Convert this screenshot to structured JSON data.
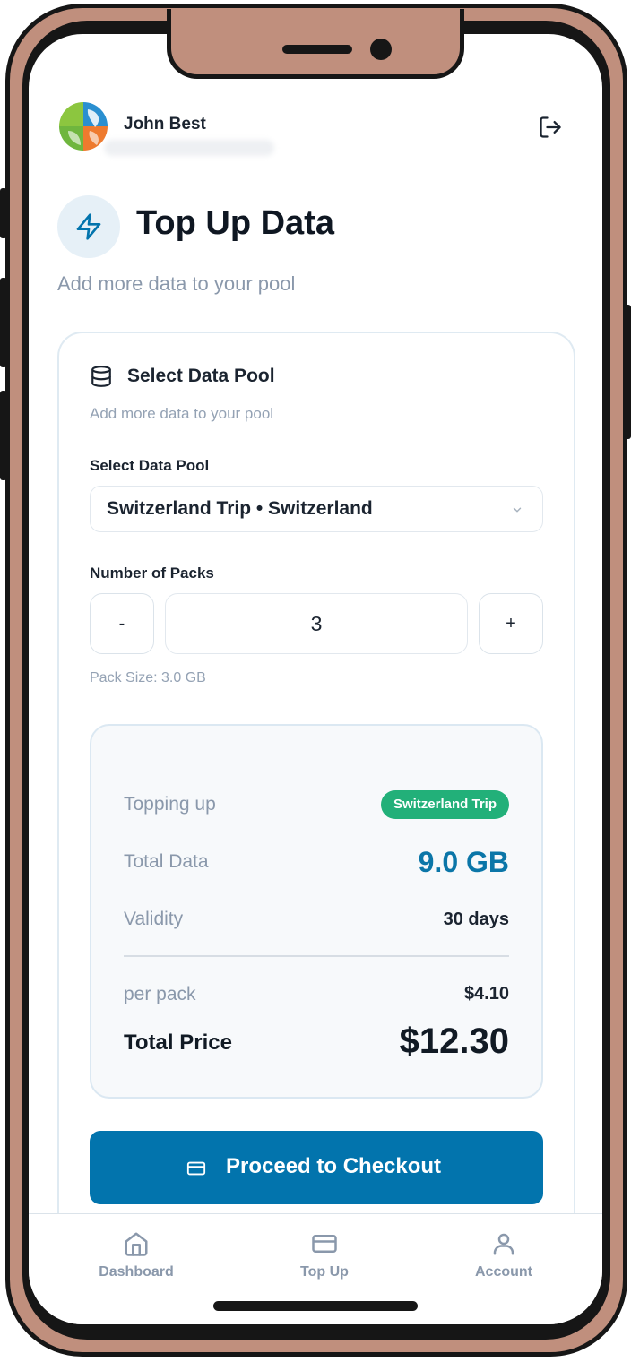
{
  "header": {
    "user_name": "John Best",
    "logout_icon": "logout-icon",
    "avatar_icon": "leaf-logo-avatar"
  },
  "page": {
    "title": "Top Up Data",
    "subtitle": "Add more data to your pool",
    "title_icon": "lightning-bolt-icon"
  },
  "card": {
    "title": "Select Data Pool",
    "subtitle": "Add more data to your pool",
    "icon": "database-icon",
    "pool_label": "Select Data Pool",
    "pool_value": "Switzerland Trip • Switzerland",
    "packs_label": "Number of Packs",
    "decrement": "-",
    "increment": "+",
    "quantity": "3",
    "pack_size": "Pack Size: 3.0 GB"
  },
  "summary": {
    "topping_up_label": "Topping up",
    "topping_up_value": "Switzerland Trip",
    "total_data_label": "Total Data",
    "total_data_value": "9.0 GB",
    "validity_label": "Validity",
    "validity_value": "30 days",
    "per_pack_label": "per pack",
    "per_pack_value": "$4.10",
    "total_price_label": "Total Price",
    "total_price_value": "$12.30"
  },
  "cta": {
    "label": "Proceed to Checkout",
    "icon": "credit-card-icon"
  },
  "nav": {
    "items": [
      {
        "label": "Dashboard",
        "icon": "home-icon"
      },
      {
        "label": "Top Up",
        "icon": "credit-card-icon"
      },
      {
        "label": "Account",
        "icon": "user-icon"
      }
    ]
  },
  "colors": {
    "primary": "#0274ad",
    "accent_blue_text": "#0b76a8",
    "badge_green": "#22b079",
    "frame": "#c08f7d"
  }
}
